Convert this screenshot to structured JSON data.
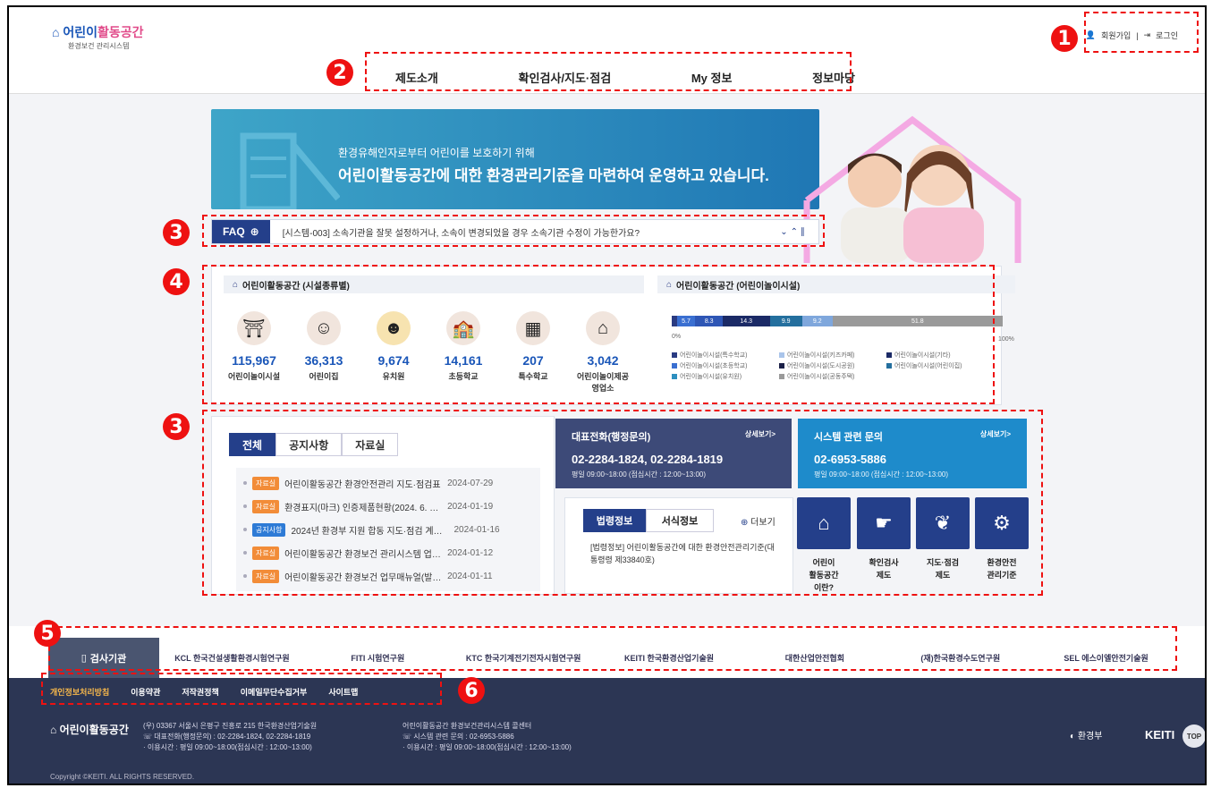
{
  "header": {
    "logo_title_part1": "어린이",
    "logo_title_part2": "활동공간",
    "logo_sub": "환경보건 관리시스템",
    "join_label": "회원가입",
    "login_label": "로그인",
    "menu": [
      "제도소개",
      "확인검사/지도·점검",
      "My 정보",
      "정보마당"
    ]
  },
  "callouts": [
    "1",
    "2",
    "3",
    "4",
    "3",
    "5",
    "6"
  ],
  "banner": {
    "line1": "환경유해인자로부터 어린이를 보호하기 위해",
    "line2": "어린이활동공간에 대한 환경관리기준을 마련하여 운영하고 있습니다."
  },
  "faq": {
    "label": "FAQ",
    "question": "[시스템-003] 소속기관을 잘못 설정하거나, 소속이 변경되었을 경우 소속기관 수정이 가능한가요?"
  },
  "stats": {
    "left_title": "어린이활동공간 (시설종류별)",
    "right_title": "어린이활동공간 (어린이놀이시설)",
    "facilities": [
      {
        "icon": "playground-icon",
        "value": "115,967",
        "label": "어린이놀이시설"
      },
      {
        "icon": "baby-icon",
        "value": "36,313",
        "label": "어린이집"
      },
      {
        "icon": "kindergarten-child-icon",
        "value": "9,674",
        "label": "유치원"
      },
      {
        "icon": "school-icon",
        "value": "14,161",
        "label": "초등학교"
      },
      {
        "icon": "blackboard-icon",
        "value": "207",
        "label": "특수학교"
      },
      {
        "icon": "play-business-icon",
        "value": "3,042",
        "label": "어린이놀이제공\n영업소"
      }
    ],
    "bar_min": "0%",
    "bar_max": "100%",
    "bar_segments": [
      {
        "value": "",
        "pct": 1.5,
        "color": "#2a3b82"
      },
      {
        "value": "5.7",
        "pct": 5.7,
        "color": "#3a6fd1"
      },
      {
        "value": "8.3",
        "pct": 8.3,
        "color": "#2e56b5"
      },
      {
        "value": "14.3",
        "pct": 14.3,
        "color": "#1b2a66"
      },
      {
        "value": "9.9",
        "pct": 9.9,
        "color": "#246f9e"
      },
      {
        "value": "9.2",
        "pct": 9.2,
        "color": "#7fa7dc"
      },
      {
        "value": "51.8",
        "pct": 51.8,
        "color": "#9a9a9a"
      }
    ],
    "legend": [
      {
        "label": "어린이놀이시설(특수학교)",
        "color": "#2a3b82"
      },
      {
        "label": "어린이놀이시설(키즈카페)",
        "color": "#a9c4ea"
      },
      {
        "label": "어린이놀이시설(기타)",
        "color": "#1b2a66"
      },
      {
        "label": "어린이놀이시설(초등학교)",
        "color": "#3a6fd1"
      },
      {
        "label": "어린이놀이시설(도시공원)",
        "color": "#1b2048"
      },
      {
        "label": "어린이놀이시설(어린이집)",
        "color": "#246f9e"
      },
      {
        "label": "어린이놀이시설(유치원)",
        "color": "#2e8fbf"
      },
      {
        "label": "어린이놀이시설(공동주택)",
        "color": "#9a9a9a"
      }
    ]
  },
  "board": {
    "tabs": [
      "전체",
      "공지사항",
      "자료실"
    ],
    "rows": [
      {
        "tag": "자료실",
        "tag_color": "#f28c38",
        "title": "어린이활동공간 환경안전관리 지도·점검표",
        "date": "2024-07-29"
      },
      {
        "tag": "자료실",
        "tag_color": "#f28c38",
        "title": "환경표지(마크) 인증제품현황(2024. 6. 3…",
        "date": "2024-01-19"
      },
      {
        "tag": "공지사항",
        "tag_color": "#2e7bd6",
        "title": "2024년 환경부 지원 합동 지도·점검 계…",
        "date": "2024-01-16"
      },
      {
        "tag": "자료실",
        "tag_color": "#f28c38",
        "title": "어린이활동공간 환경보건 관리시스템 업…",
        "date": "2024-01-12"
      },
      {
        "tag": "자료실",
        "tag_color": "#f28c38",
        "title": "어린이활동공간 환경보건 업무매뉴얼(발…",
        "date": "2024-01-11"
      }
    ]
  },
  "contact_admin": {
    "title": "대표전화(행정문의)",
    "more": "상세보기>",
    "phone": "02-2284-1824, 02-2284-1819",
    "hours": "평일 09:00~18:00 (점심시간 : 12:00~13:00)"
  },
  "contact_system": {
    "title": "시스템 관련 문의",
    "more": "상세보기>",
    "phone": "02-6953-5886",
    "hours": "평일 09:00~18:00 (점심시간 : 12:00~13:00)"
  },
  "law": {
    "tab1": "법령정보",
    "tab2": "서식정보",
    "more": "더보기",
    "text": "[법령정보] 어린이활동공간에 대한 환경안전관리기준(대통령령 제33840호)"
  },
  "quick": [
    {
      "icon": "house-child-icon",
      "label": "어린이\n활동공간\n이란?"
    },
    {
      "icon": "hand-check-icon",
      "label": "확인검사\n제도"
    },
    {
      "icon": "leaf-icon",
      "label": "지도·점검\n제도"
    },
    {
      "icon": "gear-icon",
      "label": "환경안전\n관리기준"
    }
  ],
  "partners": {
    "label": "검사기관",
    "items": [
      "KCL 한국건설생활환경시험연구원",
      "FITI 시험연구원",
      "KTC 한국기계전기전자시험연구원",
      "KEITI 한국환경산업기술원",
      "대한산업안전협회",
      "(재)한국환경수도연구원",
      "SEL 에스이엘안전기술원"
    ]
  },
  "footer": {
    "links": [
      "개인정보처리방침",
      "이용약관",
      "저작권정책",
      "이메일무단수집거부",
      "사이트맵"
    ],
    "address": "(우) 03367 서울시 은평구 진흥로 215 한국환경산업기술원",
    "admin_phone": "대표전화(행정문의) : 02-2284-1824, 02-2284-1819",
    "admin_hours": "· 이용시간 : 평일 09:00~18:00(점심시간 : 12:00~13:00)",
    "center_title": "어린이활동공간 환경보건관리시스템 콜센터",
    "center_phone": "시스템 관련 문의 : 02-6953-5886",
    "center_hours": "· 이용시간 : 평일 09:00~18:00(점심시간 : 12:00~13:00)",
    "ministry": "환경부",
    "keiti": "KEITI",
    "top": "TOP",
    "copyright": "Copyright ©KEITI. ALL RIGHTS RESERVED."
  }
}
